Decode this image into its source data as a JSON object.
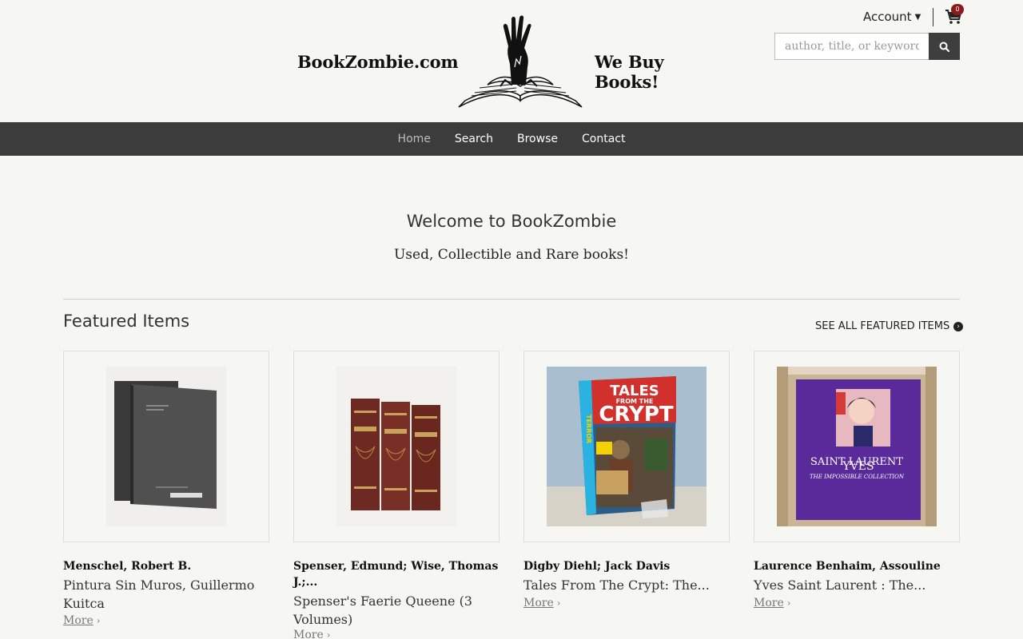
{
  "header": {
    "logo_left": "BookZombie.com",
    "logo_right": "We Buy Books!",
    "account_label": "Account",
    "cart_count": "0",
    "search_placeholder": "author, title, or keyword"
  },
  "nav": {
    "items": [
      {
        "label": "Home",
        "active": true
      },
      {
        "label": "Search"
      },
      {
        "label": "Browse"
      },
      {
        "label": "Contact"
      }
    ]
  },
  "welcome": {
    "title": "Welcome to BookZombie",
    "subtitle": "Used, Collectible and Rare books!"
  },
  "featured": {
    "title": "Featured Items",
    "see_all": "SEE ALL FEATURED ITEMS",
    "more_label": "More",
    "items": [
      {
        "author": "Menschel, Robert B.",
        "title": "Pintura Sin Muros, Guillermo Kuitca"
      },
      {
        "author": "Spenser, Edmund; Wise, Thomas J.;...",
        "title": "Spenser's Faerie Queene (3 Volumes)"
      },
      {
        "author": "Digby Diehl; Jack Davis",
        "title": "Tales From The Crypt: The...",
        "cover_text_1": "TALES",
        "cover_text_2": "FROM THE",
        "cover_text_3": "CRYPT",
        "cover_side": "TERROR"
      },
      {
        "author": "Laurence Benhaim, Assouline",
        "title": "Yves Saint Laurent : The...",
        "cover_text_1": "YVES",
        "cover_text_2": "SAINT LAURENT",
        "cover_text_3": "THE IMPOSSIBLE COLLECTION"
      }
    ]
  },
  "colors": {
    "background": "#f6f6f3",
    "navbar": "#3c3c3c",
    "search_button": "#3e3e3e",
    "cart_badge": "#8a1c1c"
  }
}
